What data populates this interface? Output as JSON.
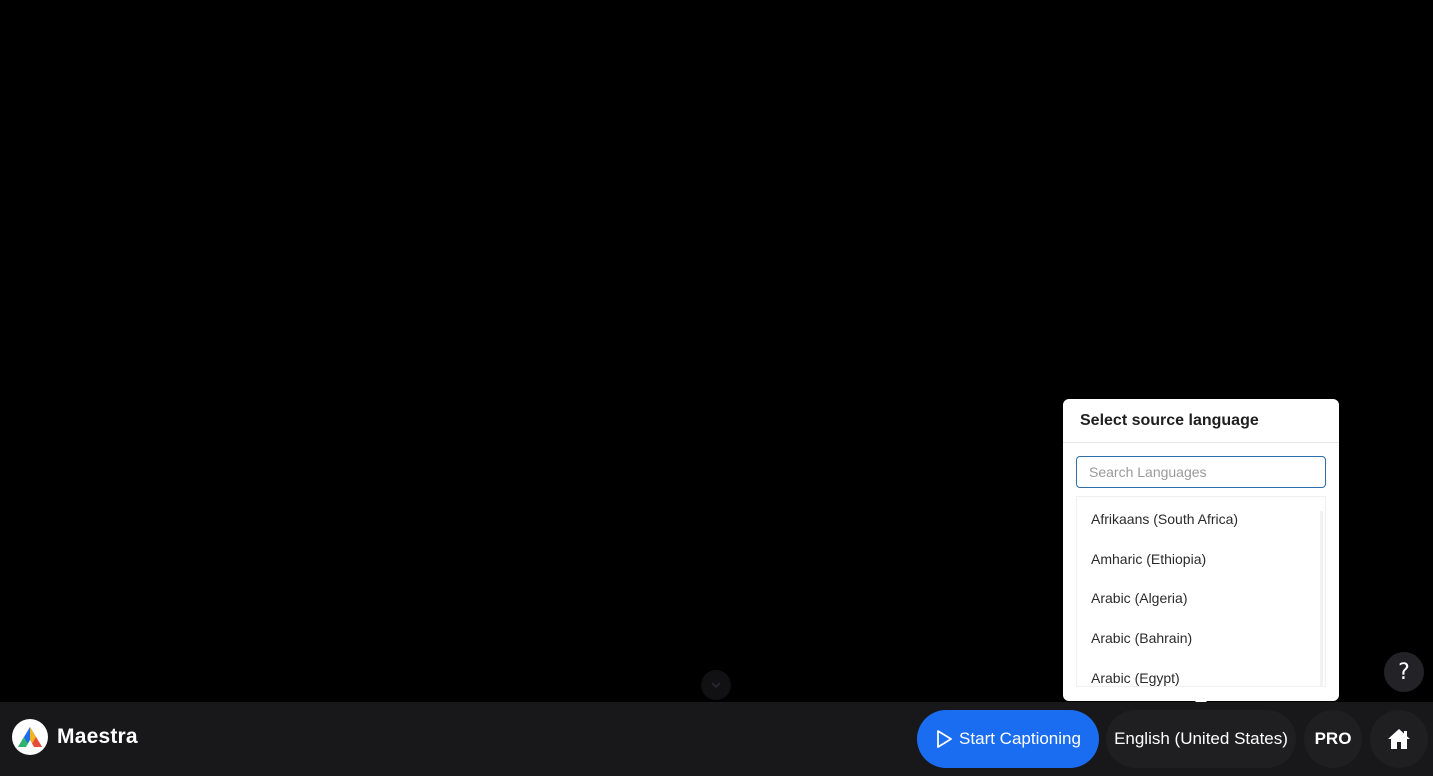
{
  "app": {
    "brand_name": "Maestra",
    "colors": {
      "accent": "#1a6cf0",
      "bar_background": "#18181b",
      "stage_background": "#000000"
    }
  },
  "stage": {
    "collapse_icon": "chevron-down-icon",
    "help_label": "?"
  },
  "toolbar": {
    "start_label": "Start Captioning",
    "start_icon": "play-icon",
    "language_label": "English (United States)",
    "pro_label": "PRO",
    "home_icon": "home-icon"
  },
  "language_popover": {
    "title": "Select source language",
    "search_placeholder": "Search Languages",
    "search_value": "",
    "languages": [
      "Afrikaans (South Africa)",
      "Amharic (Ethiopia)",
      "Arabic (Algeria)",
      "Arabic (Bahrain)",
      "Arabic (Egypt)"
    ]
  }
}
